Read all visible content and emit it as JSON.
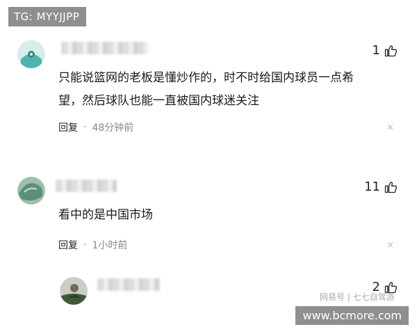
{
  "tags": {
    "top_left": "TG: MYYJJPP",
    "bottom_right": "www.bcmore.com"
  },
  "comments": [
    {
      "likes": "1",
      "text_line1": "只能说篮网的老板是懂炒作的，时不时给国内球员一点希",
      "text_line2": "望，然后球队也能一直被国内球迷关注",
      "reply_label": "回复",
      "separator": "·",
      "time": "48分钟前",
      "close": "×"
    },
    {
      "likes": "11",
      "text_line1": "看中的是中国市场",
      "reply_label": "回复",
      "separator": "·",
      "time": "1小时前",
      "close": "×"
    },
    {
      "likes": "2"
    }
  ],
  "watermark": "网易号 | 七七自驾游",
  "colors": {
    "tag_bg": "#8f8f8f",
    "avatar1_bg": "#4fb4ae",
    "avatar2_bg": "#6e9a86"
  },
  "icons": [
    "thumbs-up-icon",
    "close-icon",
    "avatar-icon"
  ]
}
